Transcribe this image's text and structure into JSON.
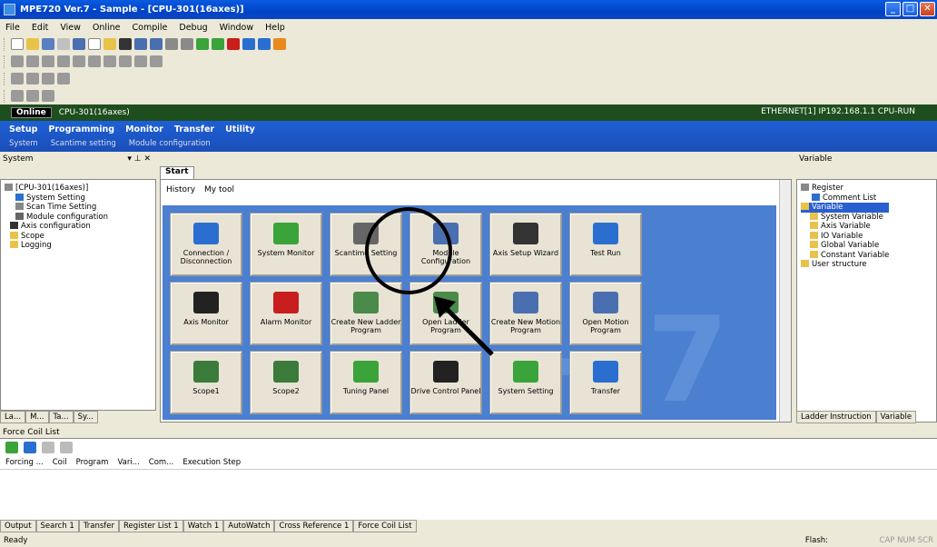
{
  "window": {
    "title": "MPE720 Ver.7 - Sample - [CPU-301(16axes)]"
  },
  "menu": [
    "File",
    "Edit",
    "View",
    "Online",
    "Compile",
    "Debug",
    "Window",
    "Help"
  ],
  "online_bar": {
    "label": "Online",
    "cpu": "CPU-301(16axes)",
    "connection": "ETHERNET[1] IP192.168.1.1 CPU-RUN"
  },
  "ribbon": {
    "tabs": [
      "Setup",
      "Programming",
      "Monitor",
      "Transfer",
      "Utility"
    ],
    "subtabs": [
      "System",
      "Scantime setting",
      "Module configuration"
    ]
  },
  "system_pane": {
    "title": "System",
    "tree": [
      "[CPU-301(16axes)]",
      "System Setting",
      "Scan Time Setting",
      "Module configuration",
      "Axis configuration",
      "Scope",
      "Logging"
    ],
    "tabs": [
      "La...",
      "M...",
      "Ta...",
      "Sy..."
    ]
  },
  "start": {
    "tab": "Start",
    "history": "History",
    "mytool": "My tool",
    "brand_text": "-.7",
    "tiles": [
      {
        "label": "Connection / Disconnection",
        "icon": "connection-icon",
        "color": "#2a6fcf"
      },
      {
        "label": "System Monitor",
        "icon": "system-monitor-icon",
        "color": "#3aa33a"
      },
      {
        "label": "Scantime Setting",
        "icon": "scantime-icon",
        "color": "#666666"
      },
      {
        "label": "Module Configuration",
        "icon": "module-config-icon",
        "color": "#4a6fb0"
      },
      {
        "label": "Axis Setup Wizard",
        "icon": "axis-wizard-icon",
        "color": "#333333"
      },
      {
        "label": "Test Run",
        "icon": "test-run-icon",
        "color": "#2a6fcf"
      },
      {
        "label": "Axis Monitor",
        "icon": "axis-monitor-icon",
        "color": "#222222"
      },
      {
        "label": "Alarm Monitor",
        "icon": "alarm-monitor-icon",
        "color": "#c81e1e"
      },
      {
        "label": "Create New Ladder Program",
        "icon": "new-ladder-icon",
        "color": "#4a8a4a"
      },
      {
        "label": "Open Ladder Program",
        "icon": "open-ladder-icon",
        "color": "#4a8a4a"
      },
      {
        "label": "Create New Motion Program",
        "icon": "new-motion-icon",
        "color": "#4a6fb0"
      },
      {
        "label": "Open Motion Program",
        "icon": "open-motion-icon",
        "color": "#4a6fb0"
      },
      {
        "label": "Scope1",
        "icon": "scope1-icon",
        "color": "#3a7a3a"
      },
      {
        "label": "Scope2",
        "icon": "scope2-icon",
        "color": "#3a7a3a"
      },
      {
        "label": "Tuning Panel",
        "icon": "tuning-panel-icon",
        "color": "#3aa33a"
      },
      {
        "label": "Drive Control Panel",
        "icon": "drive-control-icon",
        "color": "#222222"
      },
      {
        "label": "System Setting",
        "icon": "system-setting-icon",
        "color": "#3aa33a"
      },
      {
        "label": "Transfer",
        "icon": "transfer-icon",
        "color": "#2a6fcf"
      }
    ]
  },
  "variable_pane": {
    "title": "Variable",
    "tree": [
      "Register",
      "Comment List",
      "Variable",
      "System Variable",
      "Axis Variable",
      "IO Variable",
      "Global Variable",
      "Constant Variable",
      "User structure"
    ],
    "tabs": [
      "Ladder Instruction",
      "Variable"
    ]
  },
  "force_coil": {
    "title": "Force Coil List",
    "columns": [
      "Forcing ...",
      "Coil",
      "Program",
      "Vari...",
      "Com...",
      "Execution Step"
    ]
  },
  "output_tabs": [
    "Output",
    "Search 1",
    "Transfer",
    "Register List 1",
    "Watch 1",
    "AutoWatch",
    "Cross Reference 1",
    "Force Coil List"
  ],
  "status": {
    "text": "Ready",
    "flash": "Flash:",
    "caps": "CAP NUM SCR"
  }
}
